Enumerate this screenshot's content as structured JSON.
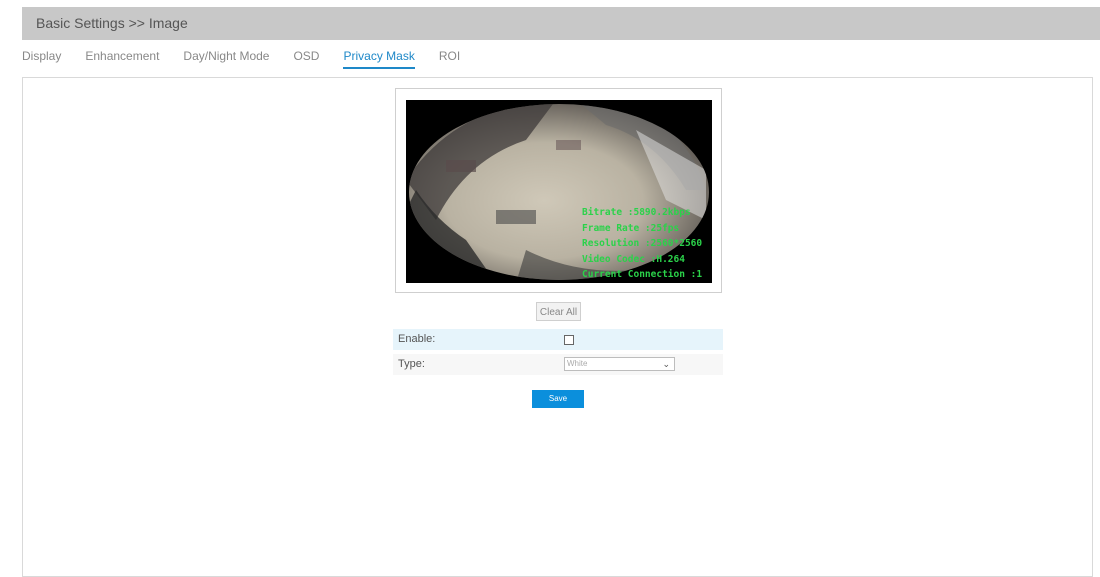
{
  "header": {
    "title": "Basic Settings >> Image"
  },
  "tabs": [
    {
      "label": "Display",
      "active": false
    },
    {
      "label": "Enhancement",
      "active": false
    },
    {
      "label": "Day/Night Mode",
      "active": false
    },
    {
      "label": "OSD",
      "active": false
    },
    {
      "label": "Privacy Mask",
      "active": true
    },
    {
      "label": "ROI",
      "active": false
    }
  ],
  "video": {
    "osd_lines": [
      "Bitrate :5890.2kbps",
      "Frame Rate :25fps",
      "Resolution :2560*2560",
      "Video Codec :H.264",
      "Current Connection :1"
    ]
  },
  "actions": {
    "clear_all": "Clear All",
    "save": "Save"
  },
  "form": {
    "enable_label": "Enable:",
    "enable_checked": false,
    "type_label": "Type:",
    "type_value": "White"
  },
  "colors": {
    "accent": "#1e88c8",
    "save_button": "#0b8fdc",
    "header_bg": "#c8c8c8",
    "osd_text": "#2bd24a"
  }
}
